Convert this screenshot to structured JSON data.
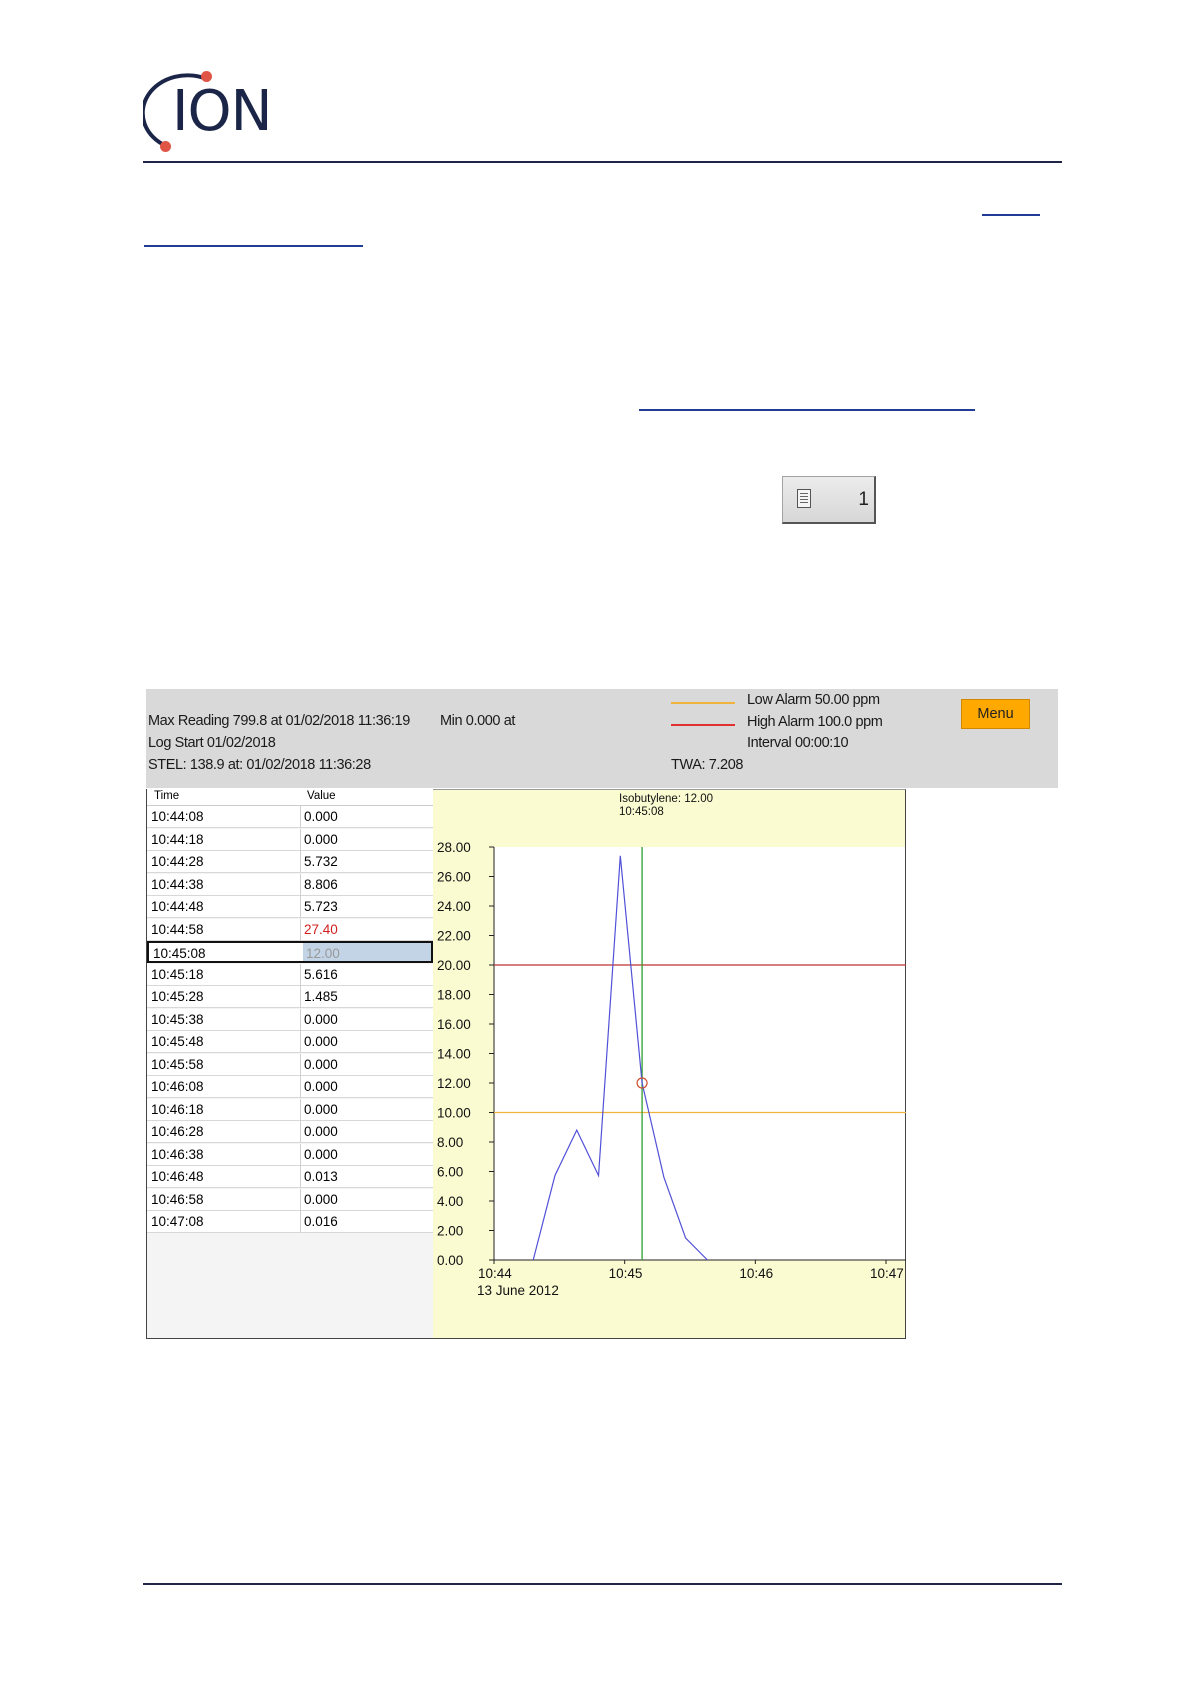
{
  "logo": {
    "text": "ION"
  },
  "log_button": {
    "number": "1",
    "icon": "document-icon"
  },
  "app": {
    "stats": {
      "max_reading": "Max Reading 799.8 at 01/02/2018 11:36:19",
      "min": "Min 0.000 at",
      "log_start": "Log Start 01/02/2018",
      "stel": "STEL: 138.9 at: 01/02/2018 11:36:28",
      "twa": "TWA: 7.208"
    },
    "legend": {
      "low_alarm": "Low Alarm 50.00 ppm",
      "high_alarm": "High Alarm 100.0 ppm",
      "interval": "Interval 00:00:10",
      "low_color": "#f0b43c",
      "high_color": "#e03030"
    },
    "menu_label": "Menu",
    "table": {
      "headers": [
        "Time",
        "Value"
      ],
      "rows": [
        [
          "10:44:08",
          "0.000"
        ],
        [
          "10:44:18",
          "0.000"
        ],
        [
          "10:44:28",
          "5.732"
        ],
        [
          "10:44:38",
          "8.806"
        ],
        [
          "10:44:48",
          "5.723"
        ],
        [
          "10:44:58",
          "27.40"
        ],
        [
          "10:45:08",
          "12.00"
        ],
        [
          "10:45:18",
          "5.616"
        ],
        [
          "10:45:28",
          "1.485"
        ],
        [
          "10:45:38",
          "0.000"
        ],
        [
          "10:45:48",
          "0.000"
        ],
        [
          "10:45:58",
          "0.000"
        ],
        [
          "10:46:08",
          "0.000"
        ],
        [
          "10:46:18",
          "0.000"
        ],
        [
          "10:46:28",
          "0.000"
        ],
        [
          "10:46:38",
          "0.000"
        ],
        [
          "10:46:48",
          "0.013"
        ],
        [
          "10:46:58",
          "0.000"
        ],
        [
          "10:47:08",
          "0.016"
        ]
      ],
      "highlight_row": 5,
      "selected_row": 6
    }
  },
  "chart_data": {
    "type": "line",
    "tooltip": [
      "Isobutylene: 12.00",
      "10:45:08"
    ],
    "date_label": "13 June 2012",
    "x_ticks": [
      "10:44",
      "10:45",
      "10:46",
      "10:47"
    ],
    "x_range": [
      "10:44:00",
      "10:47:00"
    ],
    "y_ticks": [
      "0.00",
      "2.00",
      "4.00",
      "6.00",
      "8.00",
      "10.00",
      "12.00",
      "14.00",
      "16.00",
      "18.00",
      "20.00",
      "22.00",
      "24.00",
      "26.00",
      "28.00"
    ],
    "ylim": [
      0,
      28
    ],
    "series": [
      {
        "color": "#5050d8",
        "points": [
          [
            "10:44:18",
            0.0
          ],
          [
            "10:44:28",
            5.732
          ],
          [
            "10:44:38",
            8.806
          ],
          [
            "10:44:48",
            5.723
          ],
          [
            "10:44:58",
            27.4
          ],
          [
            "10:45:08",
            12.0
          ],
          [
            "10:45:18",
            5.616
          ],
          [
            "10:45:28",
            1.485
          ],
          [
            "10:45:38",
            0.0
          ]
        ]
      }
    ],
    "high_alarm_line": {
      "value": 20,
      "color": "#c03030"
    },
    "low_alarm_line": {
      "value": 10,
      "color": "#f0b43c"
    },
    "cursor": {
      "time": "10:45:08",
      "value": 12.0,
      "color": "#2ea02e",
      "marker_color": "#d05030"
    }
  }
}
